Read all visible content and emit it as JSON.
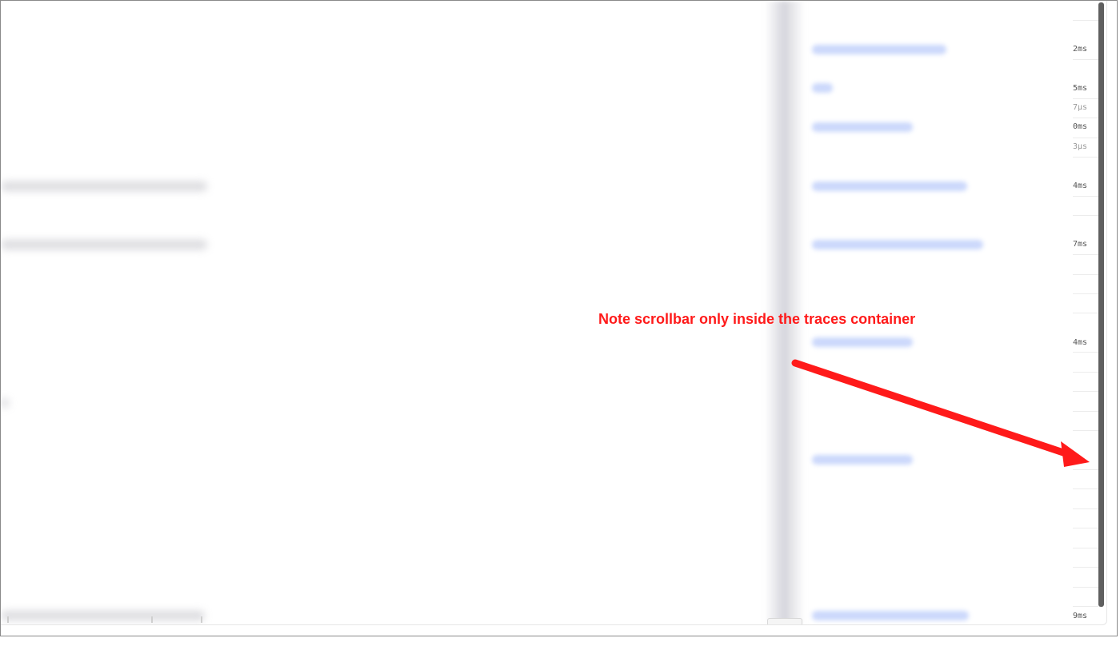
{
  "annotation": {
    "text": "Note scrollbar only inside the traces container",
    "color": "#ff1a1a"
  },
  "colors": {
    "span_bar": "#c6d4fb",
    "scrollbar_thumb": "#5f5f5f",
    "frame_border": "#8a8a8a"
  },
  "durations": [
    "2ms",
    "5ms",
    "7µs",
    "0ms",
    "3µs",
    "4ms",
    "7ms",
    "4ms",
    "9ms"
  ]
}
